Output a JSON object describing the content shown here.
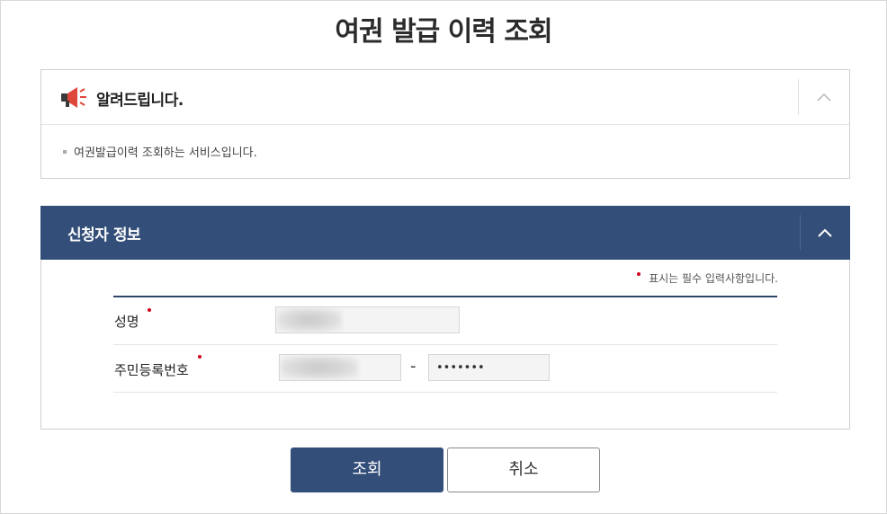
{
  "page": {
    "title": "여권 발급 이력 조회"
  },
  "notice": {
    "title": "알려드립니다.",
    "icon": "megaphone-icon",
    "toggle_icon": "chevron-up-icon",
    "items": [
      "여권발급이력 조회하는 서비스입니다."
    ]
  },
  "applicant": {
    "title": "신청자 정보",
    "toggle_icon": "chevron-up-icon",
    "required_note": "표시는 필수 입력사항입니다.",
    "fields": {
      "name": {
        "label": "성명",
        "value": ""
      },
      "rrn": {
        "label": "주민등록번호",
        "first_value": "",
        "separator": "-",
        "second_value": "•••••••"
      }
    }
  },
  "buttons": {
    "search": "조회",
    "cancel": "취소"
  },
  "colors": {
    "header_bg": "#334e79",
    "required_dot": "#d0021b",
    "primary_button": "#334e79"
  }
}
